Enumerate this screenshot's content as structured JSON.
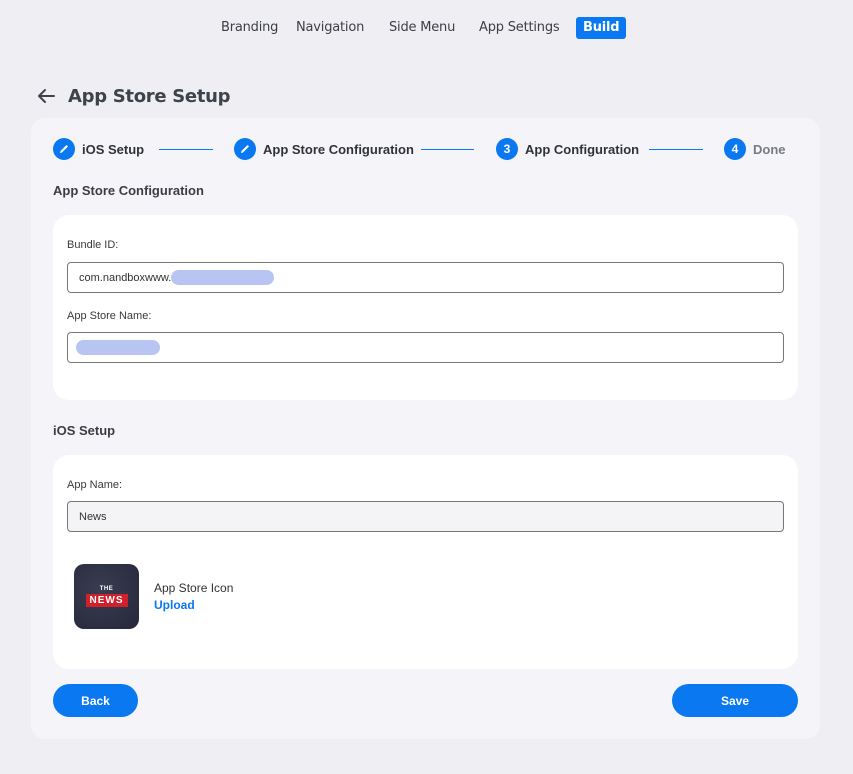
{
  "topnav": {
    "tabs": [
      {
        "label": "Branding",
        "active": false
      },
      {
        "label": "Navigation",
        "active": false
      },
      {
        "label": "Side Menu",
        "active": false
      },
      {
        "label": "App Settings",
        "active": false
      },
      {
        "label": "Build",
        "active": true
      }
    ]
  },
  "header": {
    "back_icon": "arrow-left-icon",
    "title": "App Store Setup"
  },
  "stepper": {
    "steps": [
      {
        "label": "iOS Setup",
        "icon": "pencil-icon",
        "state": "edit"
      },
      {
        "label": "App Store Configuration",
        "icon": "pencil-icon",
        "state": "edit"
      },
      {
        "label": "App Configuration",
        "number": "3",
        "state": "current"
      },
      {
        "label": "Done",
        "number": "4",
        "state": "pending"
      }
    ],
    "accent_color": "#0a78f0"
  },
  "app_store_config": {
    "section_title": "App Store Configuration",
    "bundle_id_label": "Bundle ID:",
    "bundle_id_value": "com.nandboxwww.",
    "app_store_name_label": "App Store Name:",
    "app_store_name_value": ""
  },
  "ios_setup": {
    "section_title": "iOS Setup",
    "app_name_label": "App Name:",
    "app_name_value": "News",
    "icon_the": "THE",
    "icon_news": "NEWS",
    "icon_title": "App Store Icon",
    "upload_label": "Upload"
  },
  "actions": {
    "back_label": "Back",
    "save_label": "Save"
  }
}
